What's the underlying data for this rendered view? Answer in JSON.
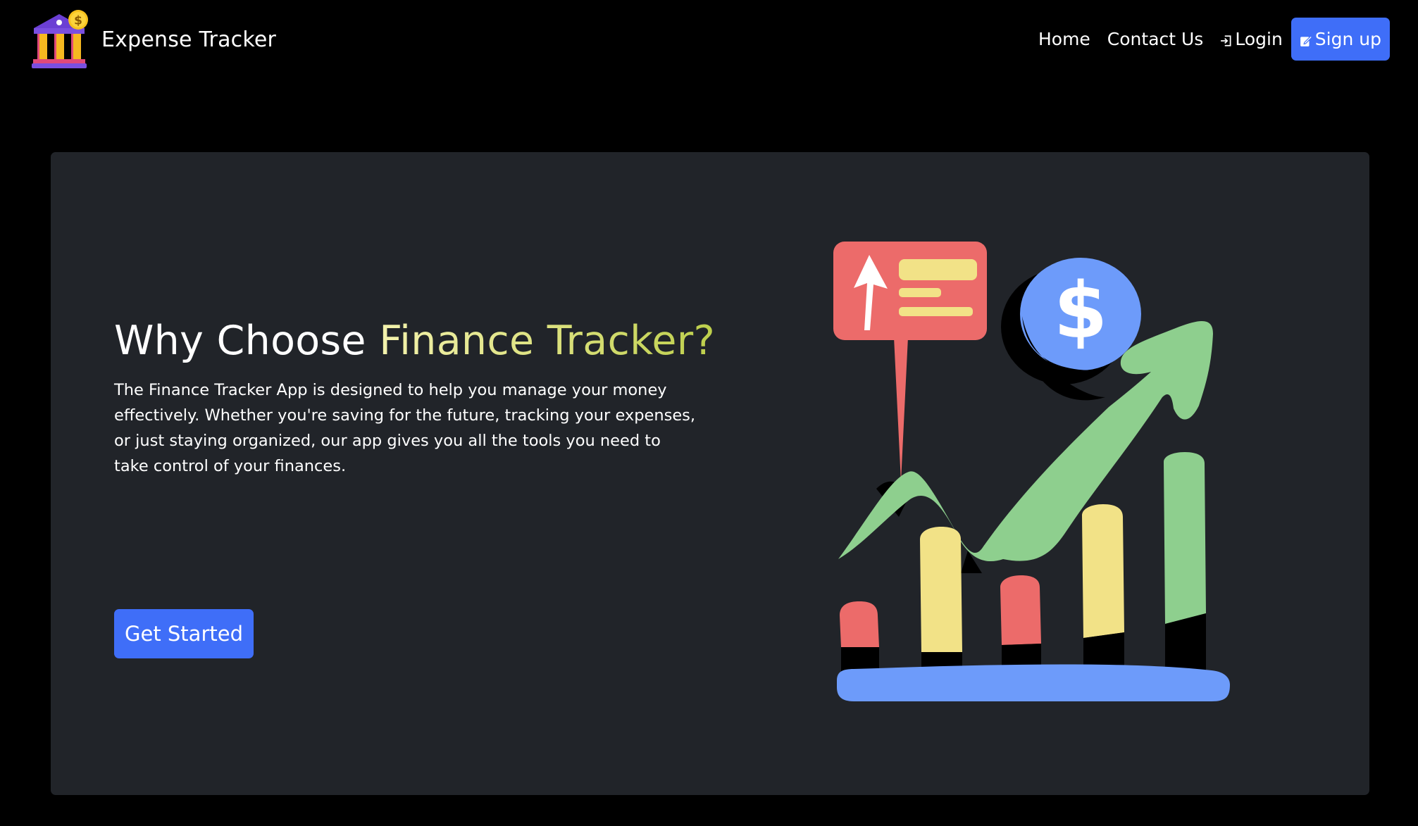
{
  "navbar": {
    "brand": {
      "name": "Expense Tracker",
      "logo_icon": "bank-building-dollar-icon"
    },
    "links": [
      {
        "label": "Home"
      },
      {
        "label": "Contact Us"
      },
      {
        "label": "Login",
        "icon": "login-icon"
      }
    ],
    "signup": {
      "label": "Sign up",
      "icon": "edit-icon"
    }
  },
  "hero": {
    "title_prefix": "Why Choose ",
    "title_accent": "Finance Tracker?",
    "description": "The Finance Tracker App is designed to help you manage your money effectively. Whether you're saving for the future, tracking your expenses, or just staying organized, our app gives you all the tools you need to take control of your finances.",
    "cta_label": "Get Started",
    "illustration": {
      "icons": [
        "growth-chart-illustration",
        "arrow-up-icon",
        "dollar-coin-icon",
        "trend-arrow-icon"
      ]
    }
  },
  "colors": {
    "page_background": "#000000",
    "card_background": "#212429",
    "primary_button": "#3f6ef8",
    "accent_gradient_start": "#f3f2ad",
    "accent_gradient_end": "#bdcf4b",
    "chart_red": "#ec6b6a",
    "chart_yellow": "#f2e287",
    "chart_green": "#8ecf8e",
    "chart_blue": "#6d9bfa"
  }
}
